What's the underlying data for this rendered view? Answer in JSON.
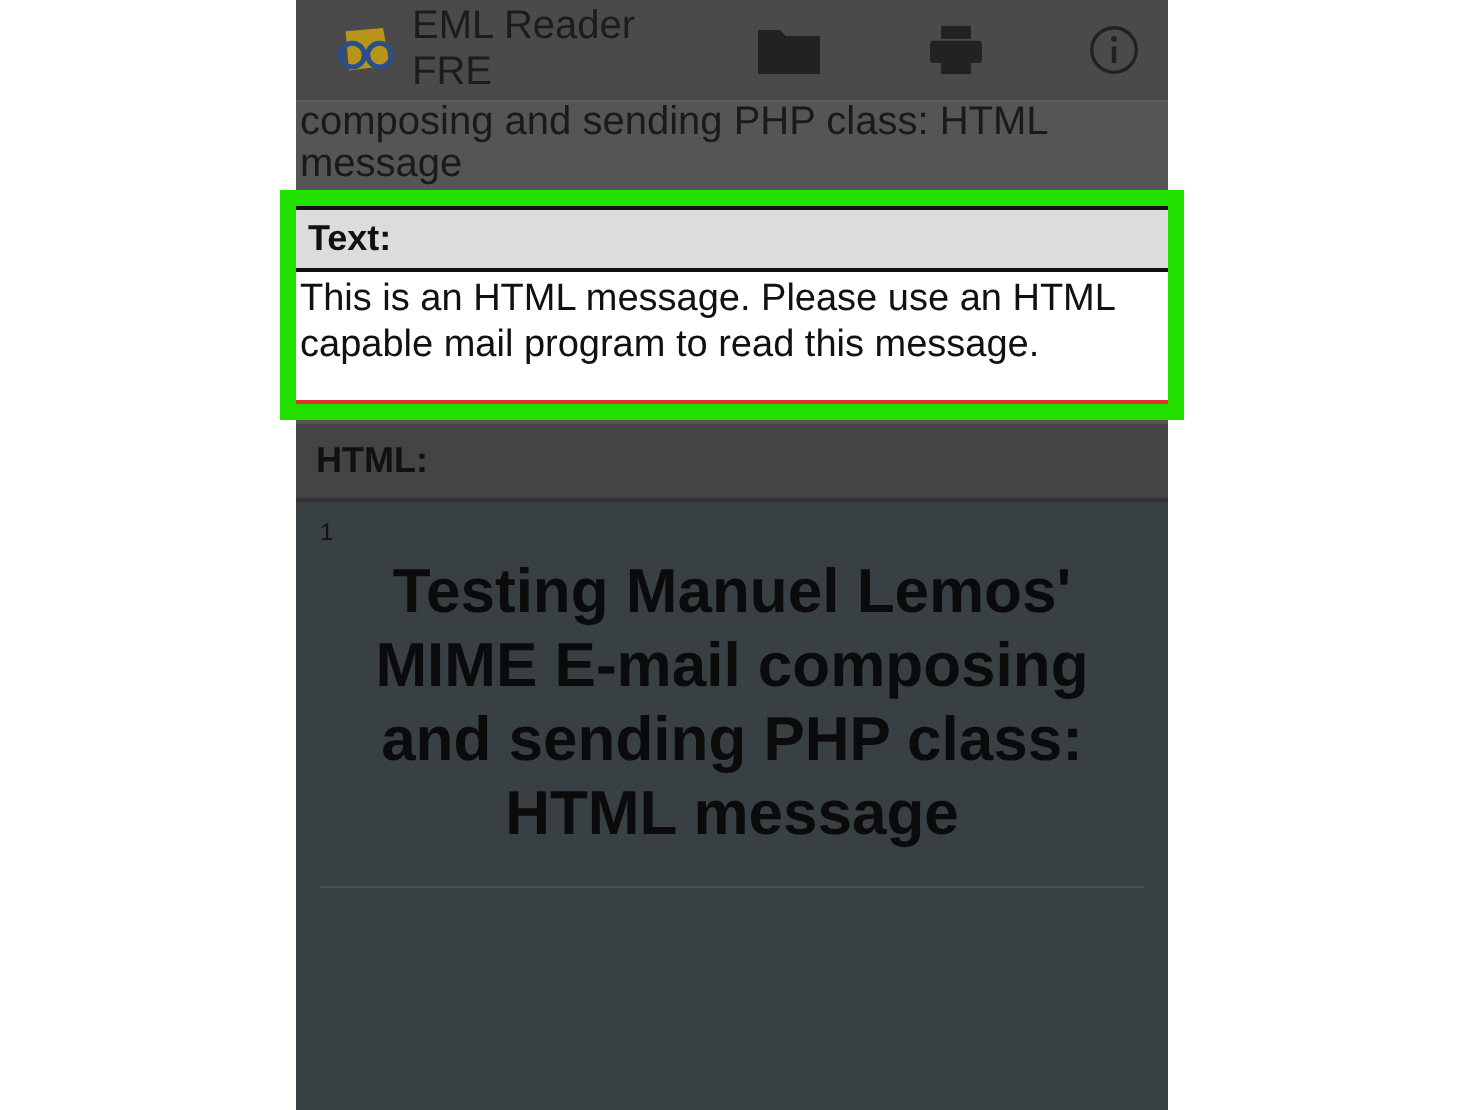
{
  "app_bar": {
    "title": "EML Reader FRE"
  },
  "subject_tail": "composing and sending PHP class: HTML message",
  "text_section": {
    "label": "Text:",
    "body": "This is an HTML message. Please use an HTML capable mail program to read this message.",
    "highlighted": true
  },
  "html_section": {
    "label": "HTML:",
    "line_number": "1",
    "heading": "Testing Manuel Lemos' MIME E-mail composing and sending PHP class: HTML message"
  }
}
